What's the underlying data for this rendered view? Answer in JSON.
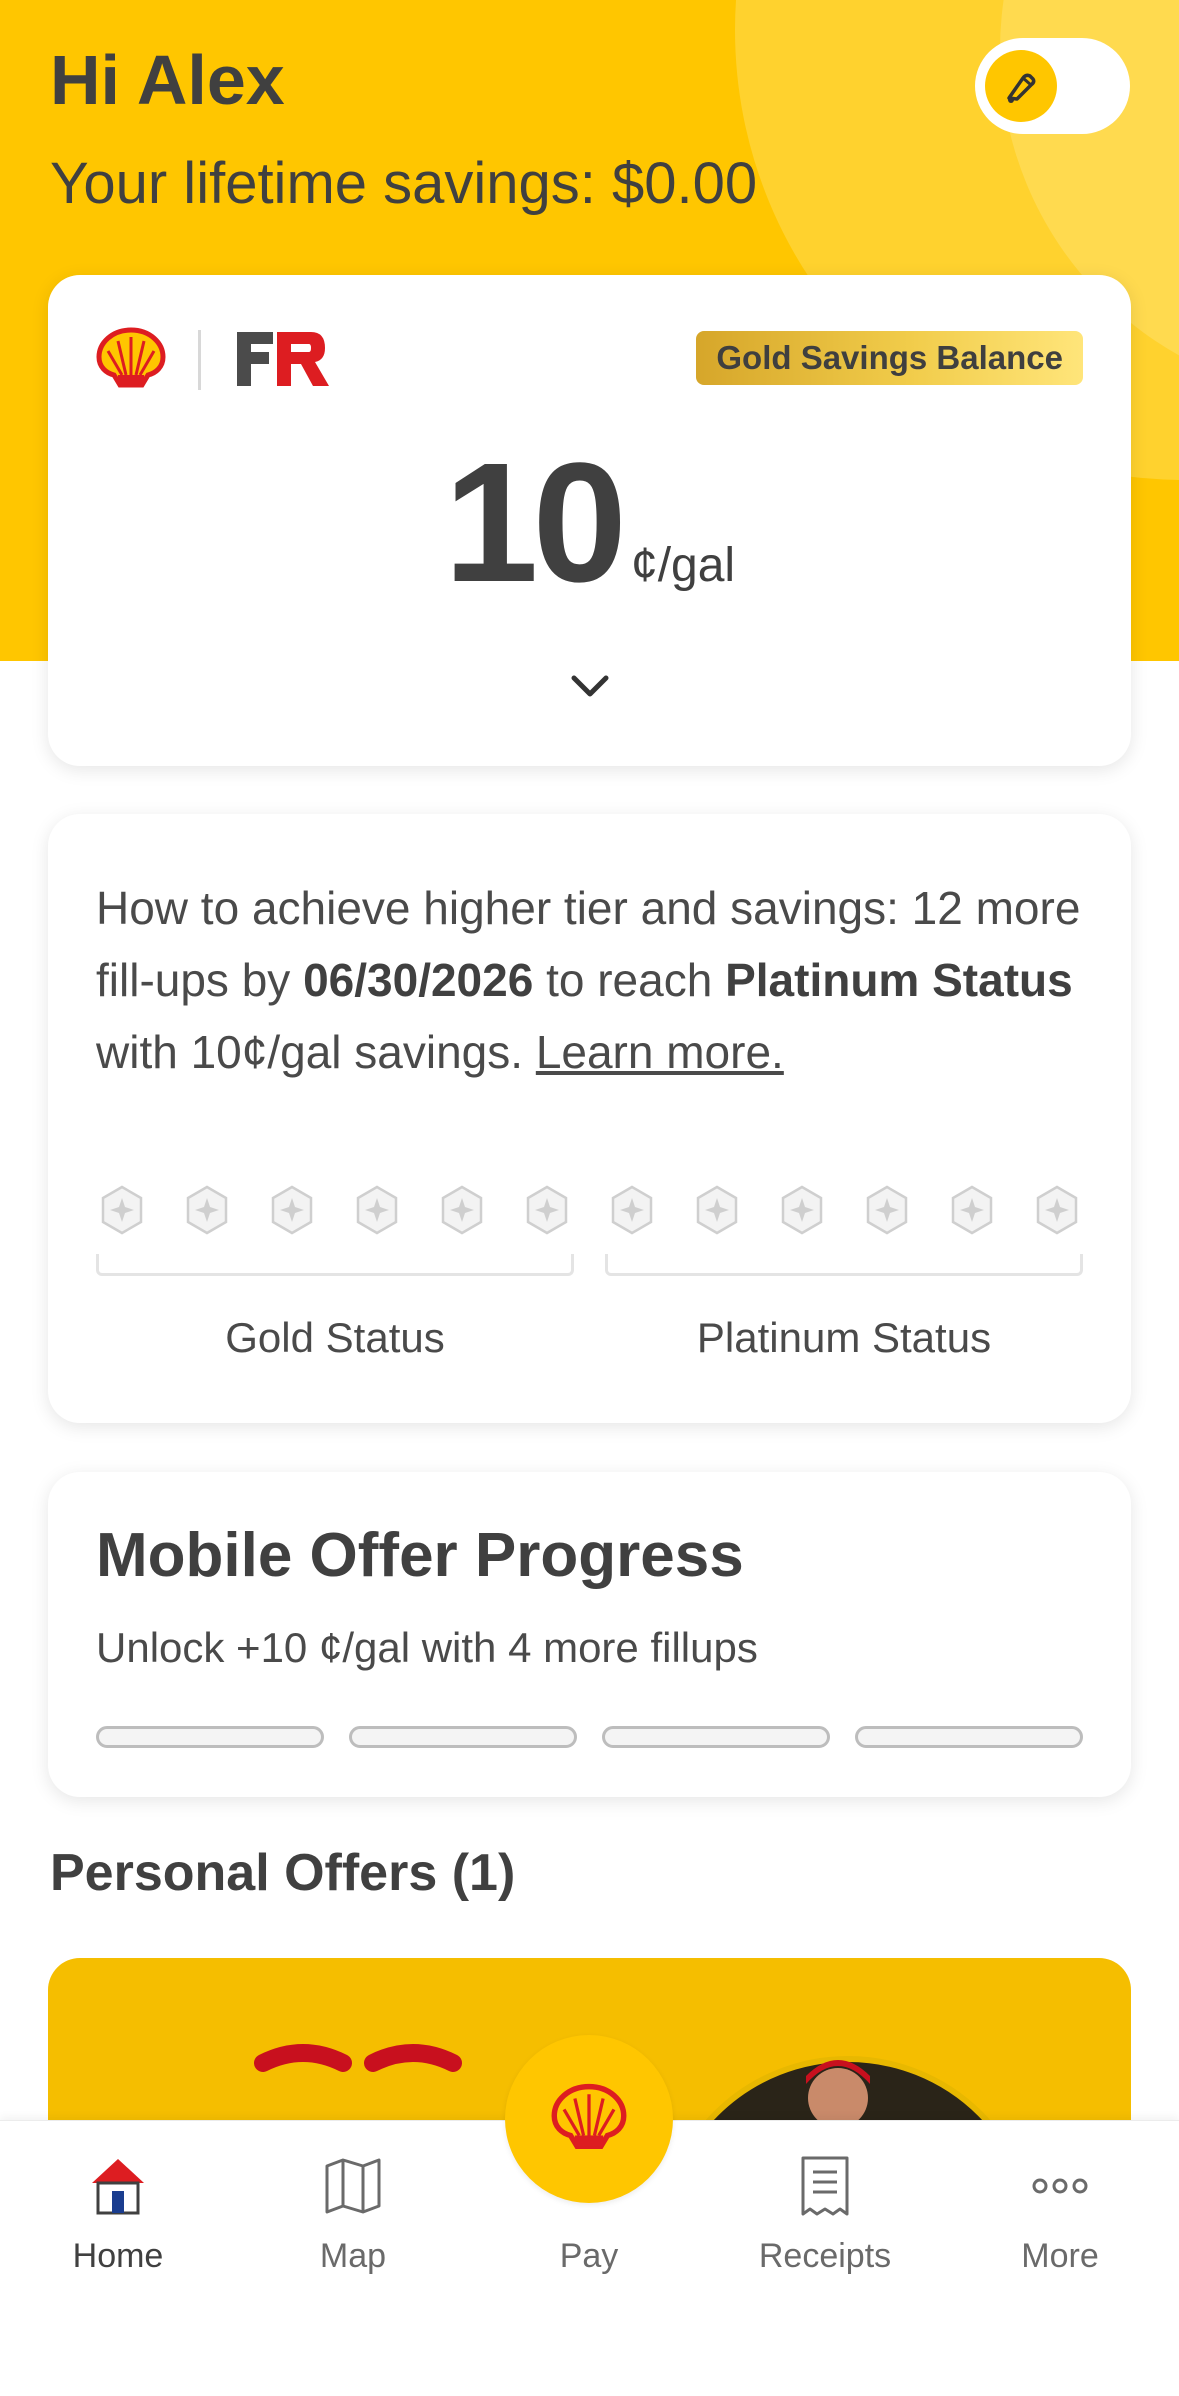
{
  "header": {
    "greeting": "Hi Alex",
    "lifetime_savings": "Your lifetime savings: $0.00",
    "toggle_icon": "fuel-nozzle-icon"
  },
  "balance_card": {
    "brands": [
      "shell-logo",
      "fuel-rewards-logo"
    ],
    "badge": "Gold Savings Balance",
    "value": "10",
    "unit": "¢/gal",
    "expand_icon": "chevron-down-icon"
  },
  "tier_card": {
    "text_part1": "How to achieve higher tier and savings: 12 more fill-ups by ",
    "date": "06/30/2026",
    "text_part2": " to reach ",
    "target_status": "Platinum Status",
    "text_part3": " with 10¢/gal savings. ",
    "link": "Learn more.",
    "fillups_completed": 0,
    "fillups_total": 12,
    "labels": [
      "Gold Status",
      "Platinum Status"
    ]
  },
  "mobile_offer": {
    "title": "Mobile Offer Progress",
    "subtitle": "Unlock +10 ¢/gal with 4 more fillups",
    "progress_completed": 0,
    "progress_total": 4
  },
  "personal_offers": {
    "title": "Personal Offers (1)"
  },
  "tabbar": {
    "items": [
      {
        "label": "Home",
        "icon": "home-icon",
        "active": true
      },
      {
        "label": "Map",
        "icon": "map-icon",
        "active": false
      },
      {
        "label": "Pay",
        "icon": "shell-pay-icon",
        "active": false
      },
      {
        "label": "Receipts",
        "icon": "receipt-icon",
        "active": false
      },
      {
        "label": "More",
        "icon": "more-dots-icon",
        "active": false
      }
    ]
  },
  "colors": {
    "brand_yellow": "#FFC600",
    "shell_red": "#DD1D21",
    "text_dark": "#404040"
  }
}
